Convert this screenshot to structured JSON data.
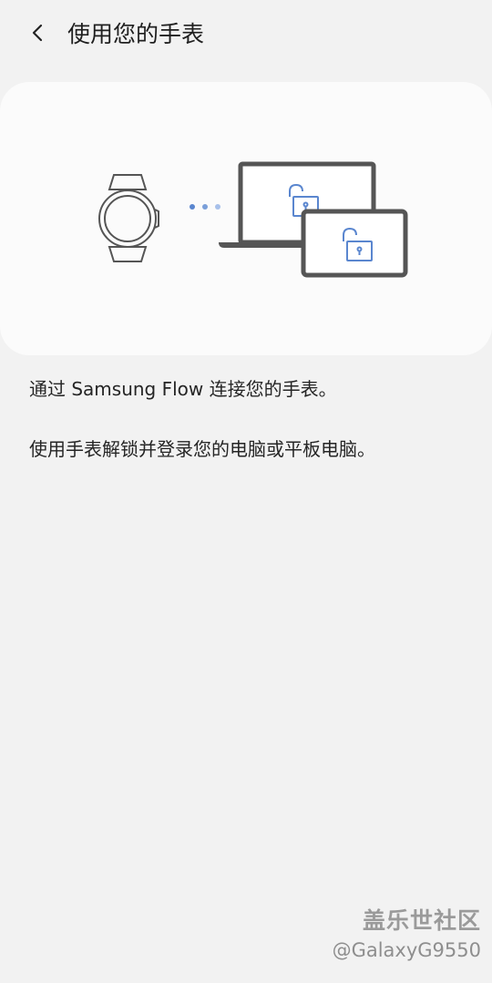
{
  "header": {
    "title": "使用您的手表",
    "back_icon": "chevron-left-icon"
  },
  "illustration": {
    "icons": [
      "watch-icon",
      "connection-dots-icon",
      "laptop-icon",
      "tablet-icon",
      "unlock-icon"
    ],
    "accent_color": "#5a86cf",
    "line_color": "#555555"
  },
  "content": {
    "line1": "通过 Samsung Flow 连接您的手表。",
    "line2": "使用手表解锁并登录您的电脑或平板电脑。"
  },
  "watermark": {
    "title": "盖乐世社区",
    "handle": "@GalaxyG9550"
  }
}
